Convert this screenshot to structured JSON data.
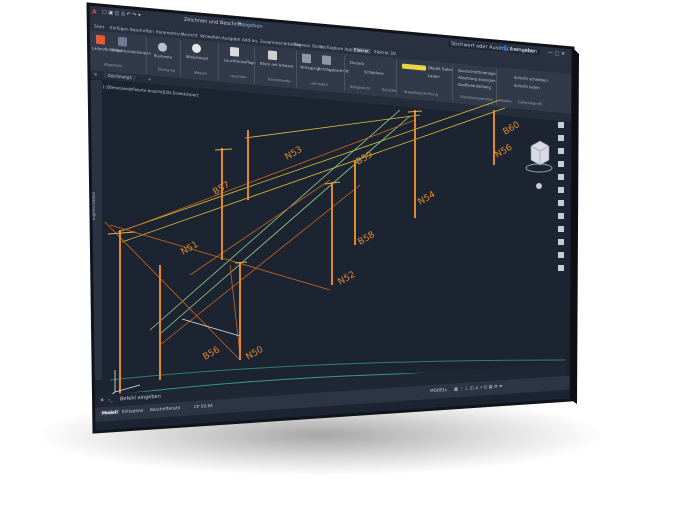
{
  "quick_access": {
    "items": [
      "Start",
      "Einfügen",
      "Beschriften",
      "Parametrisch",
      "Ansicht",
      "Verwalten",
      "Ausgabe",
      "Add-ins",
      "Zusammenarbeiten",
      "Express Tools",
      "Verfügbare Apps",
      "Elekrat",
      "Elekrat 3D"
    ],
    "doc_title": "Zeichnen und Beschrift...",
    "share": "Freigeben",
    "search_placeholder": "Stichwort oder Ausdruck eingeben",
    "user": "Anmelden"
  },
  "ribbon": {
    "groups": [
      {
        "name": "Allgemein",
        "labels": [
          "Laden/Entladen",
          "Projekteinstellungen"
        ]
      },
      {
        "name": "Elemente",
        "labels": [
          "Elemente"
        ]
      },
      {
        "name": "Masten",
        "labels": [
          "Winkelmast",
          "Masten"
        ]
      },
      {
        "name": "Leuchten",
        "labels": [
          "Leuchtenauflage"
        ]
      },
      {
        "name": "Fundamente",
        "labels": [
          "Block mit Infotext",
          "Fundamente"
        ]
      },
      {
        "name": "Leitungen",
        "labels": [
          "Verlegung",
          "Schrägabschnitt"
        ]
      },
      {
        "name": "Seilgewicht",
        "labels": [
          "Dreieck",
          "Schablone"
        ]
      },
      {
        "name": "Schilder",
        "labels": [
          "Schilder"
        ]
      },
      {
        "name": "Stapelbeschriftung",
        "labels": [
          "Objekt Daten",
          "Laden",
          "Ansicht",
          "Anzeigen"
        ]
      },
      {
        "name": "Dienstprogramme",
        "labels": [
          "Querschnittmanager",
          "Absetzerg anzeigen",
          "Grafikdarstellung"
        ]
      },
      {
        "name": "Quelle",
        "labels": [
          "Quelle"
        ]
      },
      {
        "name": "Geländeprofil",
        "labels": [
          "Schicht schreiben",
          "Schicht laden"
        ]
      }
    ],
    "tabs_active": "Elekrat"
  },
  "drawing": {
    "tab_label": "Zeichnung1",
    "viewport_label": "[-][Benutzerdefinierte Ansicht][2D-Drahtkörper]",
    "palette_label": "Eigenschaften",
    "pole_labels": [
      "N50",
      "B56",
      "N51",
      "B57",
      "N52",
      "B58",
      "N53",
      "B59",
      "N54",
      "B60",
      "N55",
      "B61",
      "N56"
    ]
  },
  "command_line": {
    "prompt": "Befehl eingeben"
  },
  "status": {
    "tabs": [
      "Modell",
      "Entladene",
      "Beschriftenstil"
    ],
    "model_label": "MODELL",
    "zoom": "CP 50,94"
  },
  "colors": {
    "pole": "#e08a2c",
    "wire_orange": "#c9661f",
    "wire_yellow": "#d8c23a",
    "wire_green": "#8fd18a",
    "viewport_bg": "#1e2532"
  }
}
